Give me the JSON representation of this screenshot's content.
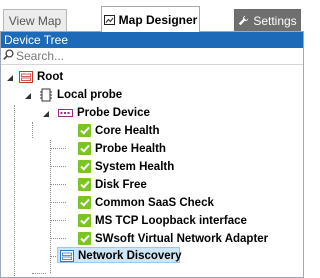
{
  "tabs": {
    "view_map": "View Map",
    "map_designer": "Map Designer",
    "settings": "Settings"
  },
  "panel": {
    "title": "Device Tree",
    "search_placeholder": "Search..."
  },
  "tree": {
    "root": "Root",
    "local_probe": "Local probe",
    "probe_device": "Probe Device",
    "sensors": [
      "Core Health",
      "Probe Health",
      "System Health",
      "Disk Free",
      "Common SaaS Check",
      "MS TCP Loopback interface",
      "SWsoft Virtual Network Adapter"
    ],
    "network_discovery": "Network Discovery"
  },
  "icons": {
    "map_designer": "map-icon",
    "settings": "wrench-icon",
    "search": "search-icon",
    "root": "group-icon",
    "local_probe": "probe-icon",
    "probe_device": "device-icon",
    "sensor": "check-icon",
    "network_discovery": "group-icon"
  },
  "colors": {
    "header_bg": "#1d6ab8",
    "sensor_ok": "#7bc424",
    "selection_bg": "#cde6f7",
    "settings_tab_bg": "#6f6f6f"
  },
  "selected_item": "Network Discovery"
}
